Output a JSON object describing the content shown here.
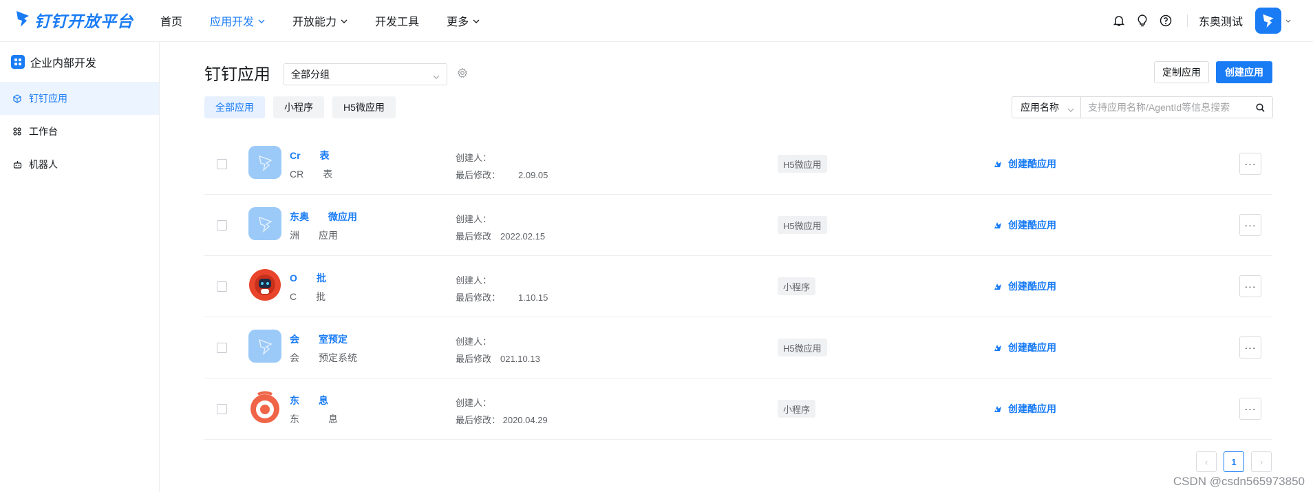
{
  "brand": {
    "name": "钉钉开放平台"
  },
  "nav": [
    {
      "label": "首页",
      "active": false,
      "has_menu": false
    },
    {
      "label": "应用开发",
      "active": true,
      "has_menu": true
    },
    {
      "label": "开放能力",
      "active": false,
      "has_menu": true
    },
    {
      "label": "开发工具",
      "active": false,
      "has_menu": false
    },
    {
      "label": "更多",
      "active": false,
      "has_menu": true
    }
  ],
  "header_right": {
    "org_name": "东奥测试"
  },
  "sidebar": {
    "title": "企业内部开发",
    "items": [
      {
        "label": "钉钉应用",
        "icon": "cube-icon",
        "active": true
      },
      {
        "label": "工作台",
        "icon": "grid-icon",
        "active": false
      },
      {
        "label": "机器人",
        "icon": "robot-icon",
        "active": false
      }
    ]
  },
  "main": {
    "title": "钉钉应用",
    "group_select": "全部分组",
    "custom_button": "定制应用",
    "create_button": "创建应用",
    "tabs": [
      {
        "label": "全部应用",
        "active": true
      },
      {
        "label": "小程序",
        "active": false
      },
      {
        "label": "H5微应用",
        "active": false
      }
    ],
    "search": {
      "type_label": "应用名称",
      "placeholder": "支持应用名称/AgentId等信息搜索"
    }
  },
  "apps": [
    {
      "name": "Cr  表",
      "desc": "CR  表",
      "creator": "创建人：",
      "modified": "最后修改：  2.09.05",
      "type": "H5微应用",
      "icon": "dingtalk-app-icon",
      "action": "创建酷应用"
    },
    {
      "name": "东奥  微应用",
      "desc": "洲  应用",
      "creator": "创建人：",
      "modified": "最后修改 2022.02.15",
      "type": "H5微应用",
      "icon": "dingtalk-app-icon",
      "action": "创建酷应用"
    },
    {
      "name": "O  批",
      "desc": "C  批",
      "creator": "创建人：",
      "modified": "最后修改：  1.10.15",
      "type": "小程序",
      "icon": "robot-app-icon",
      "action": "创建酷应用"
    },
    {
      "name": "会  室预定",
      "desc": "会  预定系统",
      "creator": "创建人：",
      "modified": "最后修改 021.10.13",
      "type": "H5微应用",
      "icon": "dingtalk-app-icon",
      "action": "创建酷应用"
    },
    {
      "name": "东  息",
      "desc": "东   息",
      "creator": "创建人：",
      "modified": "最后修改：  2020.04.29",
      "type": "小程序",
      "icon": "ring-app-icon",
      "action": "创建酷应用"
    }
  ],
  "pagination": {
    "current": "1",
    "prev": "‹",
    "next": "›"
  },
  "more_label": "···",
  "watermark": "CSDN @csdn565973850",
  "colors": {
    "accent": "#1a7cf5",
    "text": "#171a1d",
    "muted": "#5e6166",
    "tag_bg": "#f0f1f3"
  }
}
